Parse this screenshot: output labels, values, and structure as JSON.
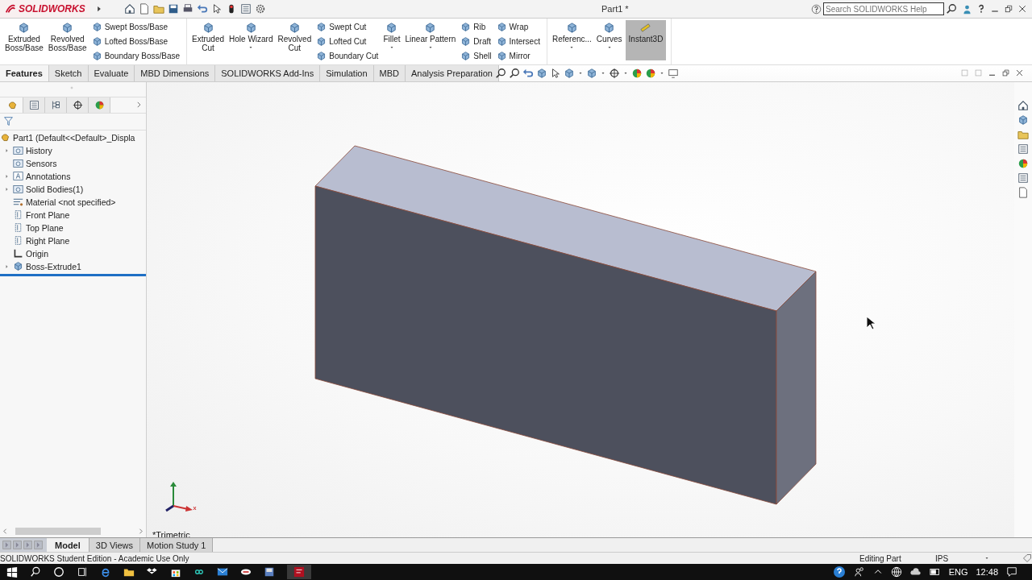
{
  "titlebar": {
    "logo": "SOLIDWORKS",
    "title": "Part1 *",
    "search": {
      "placeholder": "Search SOLIDWORKS Help"
    }
  },
  "ribbon": {
    "groups": [
      {
        "items": [
          {
            "kind": "large",
            "label": "Extruded\nBoss/Base",
            "dropdown": false
          },
          {
            "kind": "large",
            "label": "Revolved\nBoss/Base",
            "dropdown": false
          },
          {
            "kind": "stack",
            "entries": [
              "Swept Boss/Base",
              "Lofted Boss/Base",
              "Boundary Boss/Base"
            ]
          }
        ]
      },
      {
        "items": [
          {
            "kind": "large",
            "label": "Extruded\nCut",
            "dropdown": false
          },
          {
            "kind": "large",
            "label": "Hole Wizard",
            "dropdown": true
          },
          {
            "kind": "large",
            "label": "Revolved\nCut",
            "dropdown": false
          },
          {
            "kind": "stack",
            "entries": [
              "Swept Cut",
              "Lofted Cut",
              "Boundary Cut"
            ]
          },
          {
            "kind": "large",
            "label": "Fillet",
            "dropdown": true
          },
          {
            "kind": "large",
            "label": "Linear Pattern",
            "dropdown": true
          },
          {
            "kind": "stack",
            "entries": [
              "Rib",
              "Draft",
              "Shell"
            ]
          },
          {
            "kind": "stack",
            "entries": [
              "Wrap",
              "Intersect",
              "Mirror"
            ]
          }
        ]
      },
      {
        "items": [
          {
            "kind": "large",
            "label": "Referenc...",
            "dropdown": true
          },
          {
            "kind": "large",
            "label": "Curves",
            "dropdown": true
          },
          {
            "kind": "toggle",
            "label": "Instant3D",
            "selected": true
          }
        ]
      }
    ]
  },
  "command_tabs": [
    {
      "label": "Features",
      "selected": true
    },
    {
      "label": "Sketch",
      "selected": false
    },
    {
      "label": "Evaluate",
      "selected": false
    },
    {
      "label": "MBD Dimensions",
      "selected": false
    },
    {
      "label": "SOLIDWORKS Add-Ins",
      "selected": false
    },
    {
      "label": "Simulation",
      "selected": false
    },
    {
      "label": "MBD",
      "selected": false
    },
    {
      "label": "Analysis Preparation",
      "selected": false
    }
  ],
  "panel_tabs": [
    {
      "selected": true
    },
    {
      "selected": false
    },
    {
      "selected": false
    },
    {
      "selected": false
    },
    {
      "selected": false
    }
  ],
  "tree": {
    "items": [
      {
        "label": "Part1  (Default<<Default>_Displa",
        "kind": "part",
        "children": [
          {
            "label": "History",
            "kind": "folder",
            "expandable": true
          },
          {
            "label": "Sensors",
            "kind": "folder",
            "expandable": false
          },
          {
            "label": "Annotations",
            "kind": "annotation",
            "expandable": true
          },
          {
            "label": "Solid Bodies(1)",
            "kind": "folder",
            "expandable": true
          },
          {
            "label": "Material <not specified>",
            "kind": "material",
            "expandable": false
          },
          {
            "label": "Front Plane",
            "kind": "plane",
            "expandable": false
          },
          {
            "label": "Top Plane",
            "kind": "plane",
            "expandable": false
          },
          {
            "label": "Right Plane",
            "kind": "plane",
            "expandable": false
          },
          {
            "label": "Origin",
            "kind": "origin",
            "expandable": false
          },
          {
            "label": "Boss-Extrude1",
            "kind": "feature",
            "expandable": true
          }
        ]
      }
    ]
  },
  "viewport": {
    "view_name": "*Trimetric"
  },
  "bottom_tabs": [
    {
      "label": "Model",
      "selected": true
    },
    {
      "label": "3D Views",
      "selected": false
    },
    {
      "label": "Motion Study 1",
      "selected": false
    }
  ],
  "status_bar": {
    "message": "SOLIDWORKS Student Edition - Academic Use Only",
    "mode": "Editing Part",
    "units": "IPS"
  },
  "taskbar": {
    "language": "ENG",
    "time": "12:48"
  }
}
